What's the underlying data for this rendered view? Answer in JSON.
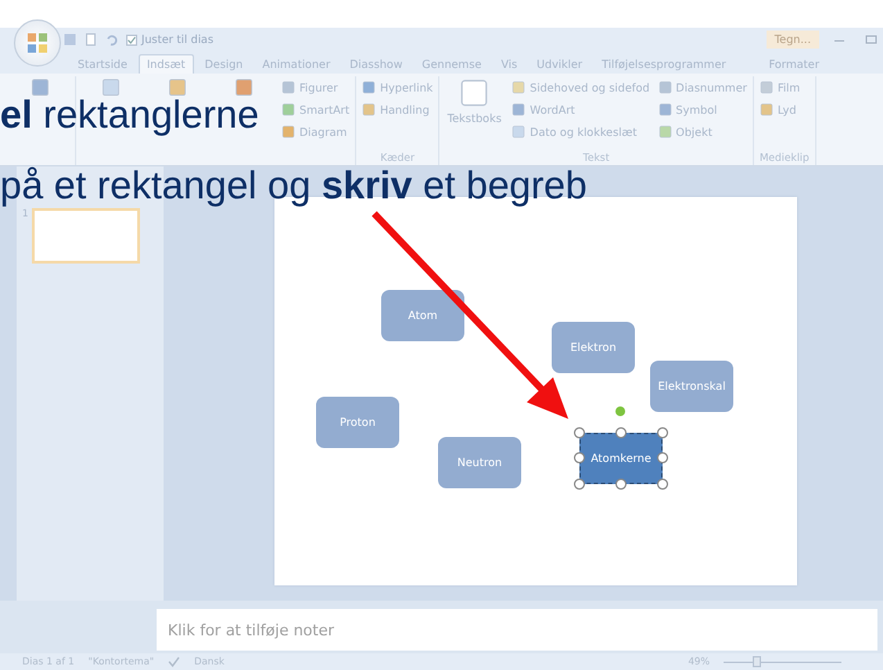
{
  "title_bar": {
    "fit_checkbox": {
      "label": "Juster til dias",
      "checked": true
    },
    "context_tab": "Tegn..."
  },
  "tabs": [
    {
      "label": "Startside",
      "selected": false
    },
    {
      "label": "Indsæt",
      "selected": true
    },
    {
      "label": "Design",
      "selected": false
    },
    {
      "label": "Animationer",
      "selected": false
    },
    {
      "label": "Diasshow",
      "selected": false
    },
    {
      "label": "Gennemse",
      "selected": false
    },
    {
      "label": "Vis",
      "selected": false
    },
    {
      "label": "Udvikler",
      "selected": false
    },
    {
      "label": "Tilføjelsesprogrammer",
      "selected": false
    },
    {
      "label": "Formater",
      "selected": false
    }
  ],
  "ribbon": {
    "groups": [
      {
        "columns": [
          {
            "kind": "large"
          }
        ]
      },
      {
        "columns": [
          {
            "kind": "large"
          },
          {
            "kind": "large"
          },
          {
            "kind": "large"
          },
          {
            "kind": "small",
            "items": [
              "Figurer",
              "SmartArt",
              "Diagram"
            ]
          }
        ]
      },
      {
        "label": "Kæder",
        "columns": [
          {
            "kind": "small",
            "items": [
              "Hyperlink",
              "Handling"
            ]
          }
        ]
      },
      {
        "label": "Tekst",
        "columns": [
          {
            "kind": "large",
            "label": "Tekstboks"
          },
          {
            "kind": "small",
            "items": [
              "Sidehoved og sidefod",
              "WordArt",
              "Dato og klokkeslæt"
            ]
          },
          {
            "kind": "small",
            "items": [
              "Diasnummer",
              "Symbol",
              "Objekt"
            ]
          }
        ]
      },
      {
        "label": "Medieklip",
        "columns": [
          {
            "kind": "small",
            "items": [
              "Film",
              "Lyd"
            ]
          }
        ]
      }
    ]
  },
  "instructions": [
    "**el** rektanglerne",
    "på et rektangel og **skriv**  et begreb"
  ],
  "slides_pane": {
    "thumbnails": [
      {
        "number": "1",
        "selected": true
      }
    ]
  },
  "slide": {
    "shapes": [
      {
        "label": "Atom",
        "selected": false
      },
      {
        "label": "Elektron",
        "selected": false
      },
      {
        "label": "Elektronskal",
        "selected": false
      },
      {
        "label": "Proton",
        "selected": false
      },
      {
        "label": "Neutron",
        "selected": false
      },
      {
        "label": "Atomkerne",
        "selected": true
      }
    ]
  },
  "notes": {
    "placeholder": "Klik for at tilføje noter"
  },
  "status_bar": {
    "slide": "Dias 1 af 1",
    "theme": "\"Kontortema\"",
    "language": "Dansk",
    "zoom": "49%",
    "zoom_slider": {
      "level": 0.25
    }
  }
}
